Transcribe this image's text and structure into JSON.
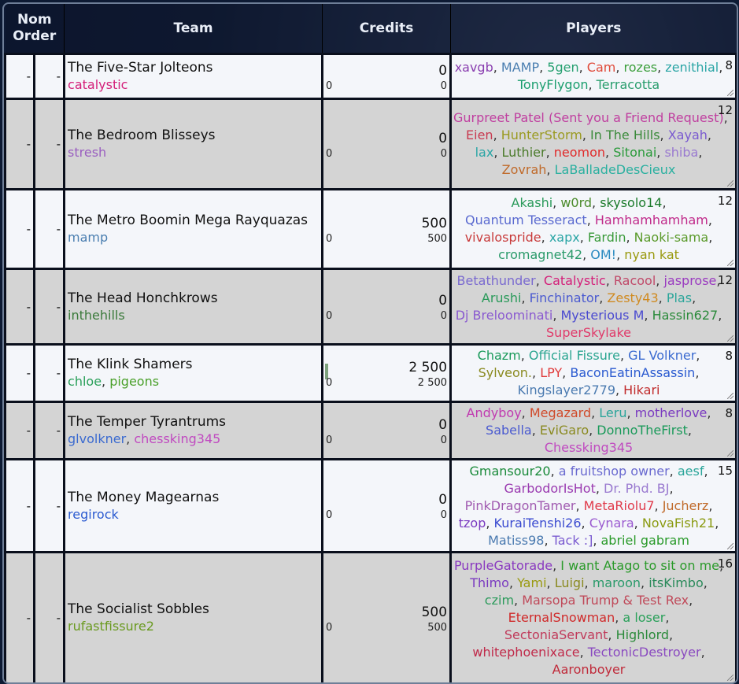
{
  "header": {
    "nom": "Nom",
    "order": "Order",
    "team": "Team",
    "credits": "Credits",
    "players": "Players"
  },
  "rows": [
    {
      "nom": "-",
      "order": "-",
      "name": "The Five-Star Jolteons",
      "managers": [
        {
          "n": "catalystic",
          "c": "#d4207a"
        }
      ],
      "credits": "0",
      "credits_small": "0",
      "credits_left": "0",
      "count": "8",
      "players": [
        {
          "n": "xavgb",
          "c": "#8a3fb0"
        },
        {
          "n": "MAMP",
          "c": "#4a7eb0"
        },
        {
          "n": "5gen",
          "c": "#26a070"
        },
        {
          "n": "Cam",
          "c": "#e04a3a"
        },
        {
          "n": "rozes",
          "c": "#3a9e3a"
        },
        {
          "n": "zenithial",
          "c": "#2aa5a5"
        },
        {
          "n": "TonyFlygon",
          "c": "#1a9e6e"
        },
        {
          "n": "Terracotta",
          "c": "#2a9e6e"
        }
      ]
    },
    {
      "nom": "-",
      "order": "-",
      "name": "The Bedroom Blisseys",
      "managers": [
        {
          "n": "stresh",
          "c": "#9a5fc0"
        }
      ],
      "credits": "0",
      "credits_small": "0",
      "credits_left": "0",
      "count": "12",
      "players": [
        {
          "n": "Gurpreet Patel (Sent you a Friend Request)",
          "c": "#c040a0"
        },
        {
          "n": "Eien",
          "c": "#c83a50"
        },
        {
          "n": "HunterStorm",
          "c": "#9a9a20"
        },
        {
          "n": "In The Hills",
          "c": "#3a8a3a"
        },
        {
          "n": "Xayah",
          "c": "#7a5ad0"
        },
        {
          "n": "lax",
          "c": "#2aa5a5"
        },
        {
          "n": "Luthier",
          "c": "#4a7a2a"
        },
        {
          "n": "neomon",
          "c": "#e02a2a"
        },
        {
          "n": "Sitonai",
          "c": "#2a9a3a"
        },
        {
          "n": "shiba",
          "c": "#9a7ad0"
        },
        {
          "n": "Zovrah",
          "c": "#c06a2a"
        },
        {
          "n": "LaBalladeDesCieux",
          "c": "#2ab0a0"
        }
      ]
    },
    {
      "nom": "-",
      "order": "-",
      "name": "The Metro Boomin Mega Rayquazas",
      "managers": [
        {
          "n": "mamp",
          "c": "#4a7eb0"
        }
      ],
      "credits": "500",
      "credits_small": "500",
      "credits_left": "0",
      "count": "12",
      "players": [
        {
          "n": "Akashi",
          "c": "#2a9a5a"
        },
        {
          "n": "w0rd",
          "c": "#4a8a2a"
        },
        {
          "n": "skysolo14",
          "c": "#1a7a2a"
        },
        {
          "n": "Quantum Tesseract",
          "c": "#5a6ad0"
        },
        {
          "n": "Hamhamhamham",
          "c": "#c02a8a"
        },
        {
          "n": "vivalospride",
          "c": "#c83a3a"
        },
        {
          "n": "xapx",
          "c": "#2aa5a5"
        },
        {
          "n": "Fardin",
          "c": "#3a9a3a"
        },
        {
          "n": "Naoki-sama",
          "c": "#5a9a2a"
        },
        {
          "n": "cromagnet42",
          "c": "#2a9a6a"
        },
        {
          "n": "OM!",
          "c": "#2a8ac0"
        },
        {
          "n": "nyan kat",
          "c": "#9a9a10"
        }
      ]
    },
    {
      "nom": "-",
      "order": "-",
      "name": "The Head Honchkrows",
      "managers": [
        {
          "n": "inthehills",
          "c": "#3a7a3a"
        }
      ],
      "credits": "0",
      "credits_small": "0",
      "credits_left": "0",
      "count": "12",
      "players": [
        {
          "n": "Betathunder",
          "c": "#7a6ad0"
        },
        {
          "n": "Catalystic",
          "c": "#d4207a"
        },
        {
          "n": "Racool",
          "c": "#c04a6a"
        },
        {
          "n": "jasprose",
          "c": "#9a3ac0"
        },
        {
          "n": "Arushi",
          "c": "#2a9a5a"
        },
        {
          "n": "Finchinator",
          "c": "#4a5ad0"
        },
        {
          "n": "Zesty43",
          "c": "#d08a20"
        },
        {
          "n": "Plas",
          "c": "#2aa59a"
        },
        {
          "n": "Dj Breloominati",
          "c": "#8a5ad0"
        },
        {
          "n": "Mysterious M",
          "c": "#4a4ad0"
        },
        {
          "n": "Hassin627",
          "c": "#2a8a3a"
        },
        {
          "n": "SuperSkylake",
          "c": "#e03a6a"
        }
      ]
    },
    {
      "nom": "-",
      "order": "-",
      "name": "The Klink Shamers",
      "managers": [
        {
          "n": "chloe",
          "c": "#2aa05a"
        },
        {
          "n": "pigeons",
          "c": "#4aa02a"
        }
      ],
      "credits": "2 500",
      "credits_small": "2 500",
      "credits_left": "0",
      "bar": 0.9,
      "count": "8",
      "players": [
        {
          "n": "Chazm",
          "c": "#1a9a5a"
        },
        {
          "n": "Official Fissure",
          "c": "#2aa590"
        },
        {
          "n": "GL Volkner",
          "c": "#3a6ad0"
        },
        {
          "n": "Sylveon.",
          "c": "#8a8a20"
        },
        {
          "n": "LPY",
          "c": "#e03a3a"
        },
        {
          "n": "BaconEatinAssassin",
          "c": "#2a5ad0"
        },
        {
          "n": "Kingslayer2779",
          "c": "#4a7ab0"
        },
        {
          "n": "Hikari",
          "c": "#c02a2a"
        }
      ]
    },
    {
      "nom": "-",
      "order": "-",
      "name": "The Temper Tyrantrums",
      "managers": [
        {
          "n": "glvolkner",
          "c": "#3a6ad0"
        },
        {
          "n": "chessking345",
          "c": "#c04ac0"
        }
      ],
      "credits": "0",
      "credits_small": "0",
      "credits_left": "0",
      "count": "8",
      "players": [
        {
          "n": "Andyboy",
          "c": "#c03ab0"
        },
        {
          "n": "Megazard",
          "c": "#d04a2a"
        },
        {
          "n": "Leru",
          "c": "#2aa59a"
        },
        {
          "n": "motherlove",
          "c": "#7a3ac0"
        },
        {
          "n": "Sabella",
          "c": "#4a5ad0"
        },
        {
          "n": "EviGaro",
          "c": "#8a8a20"
        },
        {
          "n": "DonnoTheFirst",
          "c": "#1a9a5a"
        },
        {
          "n": "Chessking345",
          "c": "#c04ac0"
        }
      ]
    },
    {
      "nom": "-",
      "order": "-",
      "name": "The Money Magearnas",
      "managers": [
        {
          "n": "regirock",
          "c": "#2a5ad0"
        }
      ],
      "credits": "0",
      "credits_small": "0",
      "credits_left": "0",
      "count": "15",
      "players": [
        {
          "n": "Gmansour20",
          "c": "#1a8a3a"
        },
        {
          "n": "a fruitshop owner",
          "c": "#6a6ad0"
        },
        {
          "n": "aesf",
          "c": "#2aa59a"
        },
        {
          "n": "GarbodorIsHot",
          "c": "#9a3ab0"
        },
        {
          "n": "Dr. Phd. BJ",
          "c": "#9a7ad0"
        },
        {
          "n": "PinkDragonTamer",
          "c": "#a05ab0"
        },
        {
          "n": "MetaRiolu7",
          "c": "#e03a4a"
        },
        {
          "n": "Jucherz",
          "c": "#c06a2a"
        },
        {
          "n": "tzop",
          "c": "#7a3ac0"
        },
        {
          "n": "KuraiTenshi26",
          "c": "#3a4ad0"
        },
        {
          "n": "Cynara",
          "c": "#9a5ad0"
        },
        {
          "n": "NovaFish21",
          "c": "#8a9a10"
        },
        {
          "n": "Matiss98",
          "c": "#4a7ab0"
        },
        {
          "n": "Tack :]",
          "c": "#7a5ad0"
        },
        {
          "n": "abriel gabram",
          "c": "#2a9a2a"
        }
      ]
    },
    {
      "nom": "-",
      "order": "-",
      "name": "The Socialist Sobbles",
      "managers": [
        {
          "n": "rufastfissure2",
          "c": "#6a9a20"
        }
      ],
      "credits": "500",
      "credits_small": "500",
      "credits_left": "0",
      "count": "16",
      "players": [
        {
          "n": "PurpleGatorade",
          "c": "#8a3ac0"
        },
        {
          "n": "I want Atago to sit on me",
          "c": "#2a9a2a"
        },
        {
          "n": "Thimo",
          "c": "#7a3ac0"
        },
        {
          "n": "Yami",
          "c": "#9a9a10"
        },
        {
          "n": "Luigi",
          "c": "#8a8a20"
        },
        {
          "n": "maroon",
          "c": "#2a9a6a"
        },
        {
          "n": "itsKimbo",
          "c": "#2a8a5a"
        },
        {
          "n": "czim",
          "c": "#2a9a5a"
        },
        {
          "n": "Marsopa Trump & Test Rex",
          "c": "#c04a5a"
        },
        {
          "n": "EternalSnowman",
          "c": "#d02a2a"
        },
        {
          "n": "a loser",
          "c": "#2aa05a"
        },
        {
          "n": "SectoniaServant",
          "c": "#c03a5a"
        },
        {
          "n": "Highlord",
          "c": "#2a8a3a"
        },
        {
          "n": "whitephoenixace",
          "c": "#c02a4a"
        },
        {
          "n": "TectonicDestroyer",
          "c": "#8a4ac0"
        },
        {
          "n": "Aaronboyer",
          "c": "#c02a3a"
        }
      ]
    }
  ]
}
